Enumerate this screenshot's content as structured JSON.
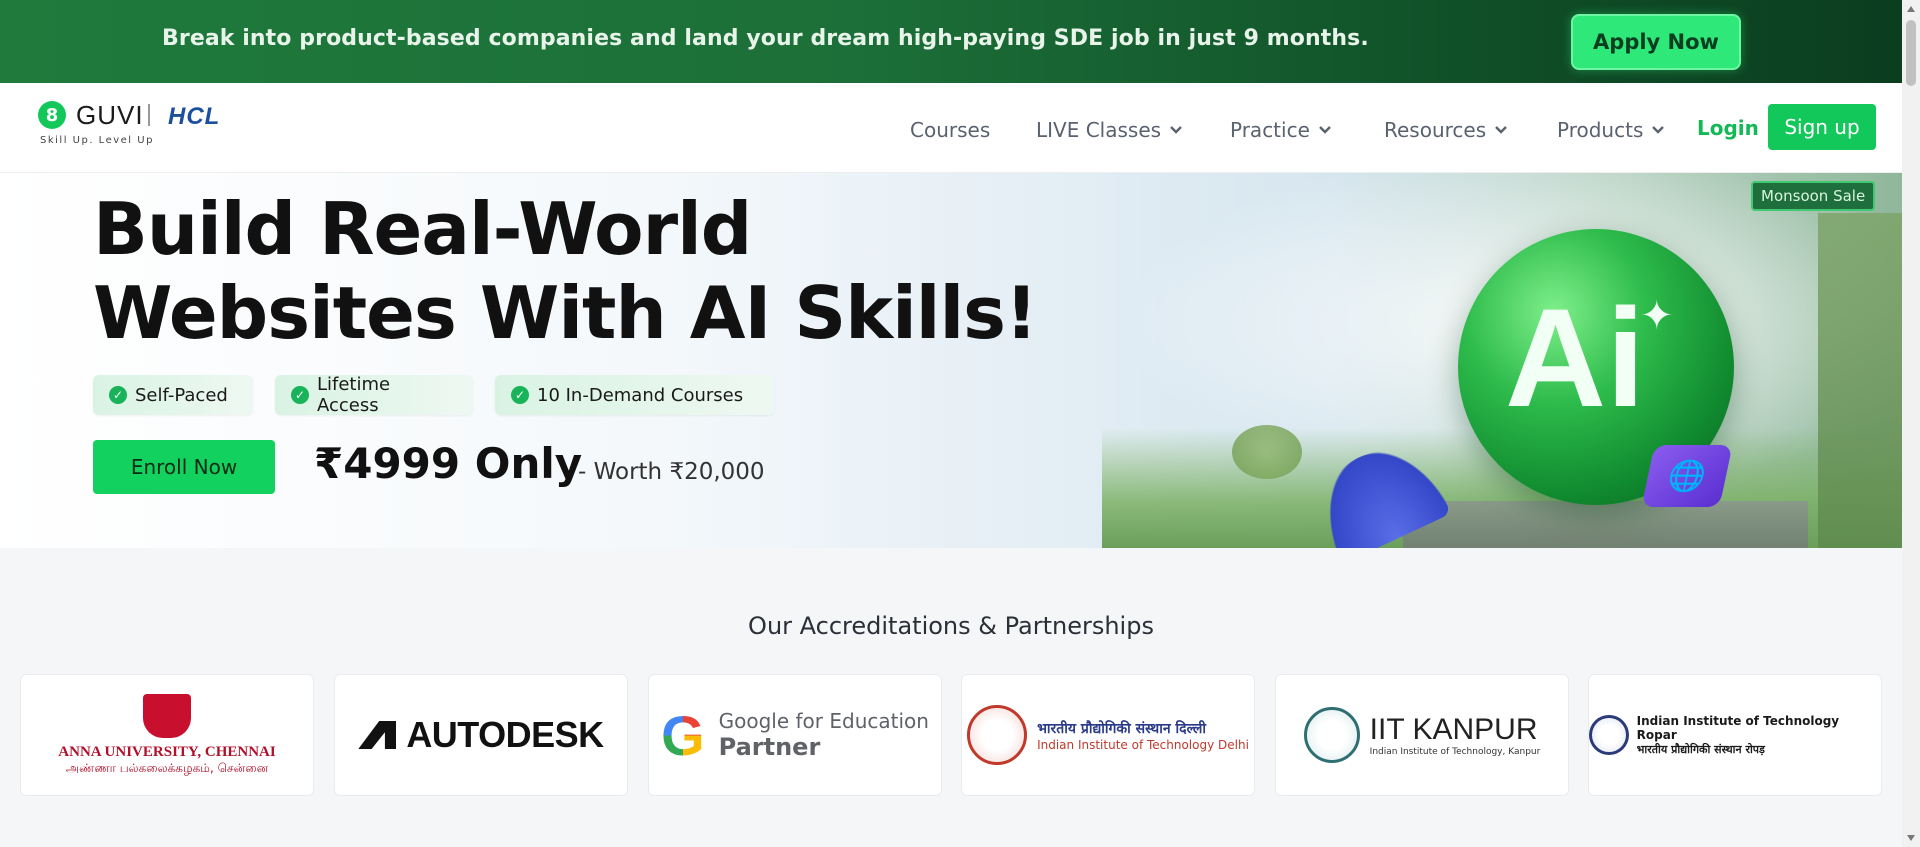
{
  "promo": {
    "text": "Break into product-based companies and land your dream high-paying SDE job in just 9 months.",
    "cta": "Apply Now"
  },
  "nav": {
    "logo": {
      "name": "GUVI",
      "partner": "HCL",
      "tagline": "Skill Up. Level Up"
    },
    "items": [
      {
        "label": "Courses",
        "dropdown": false
      },
      {
        "label": "LIVE Classes",
        "dropdown": true
      },
      {
        "label": "Practice",
        "dropdown": true
      },
      {
        "label": "Resources",
        "dropdown": true
      },
      {
        "label": "Products",
        "dropdown": true
      }
    ],
    "login": "Login",
    "signup": "Sign up"
  },
  "hero": {
    "title_line1": "Build Real-World",
    "title_line2": "Websites With AI Skills!",
    "chips": [
      "Self-Paced",
      "Lifetime Access",
      "10 In-Demand Courses"
    ],
    "enroll": "Enroll Now",
    "price": "₹4999 Only",
    "worth": "- Worth ₹20,000",
    "badge": "Monsoon Sale",
    "ai_text": "Ai"
  },
  "accreditations": {
    "title": "Our Accreditations & Partnerships",
    "anna": {
      "name": "ANNA UNIVERSITY, CHENNAI",
      "sub": "அண்ணா பல்கலைக்கழகம், சென்னை"
    },
    "autodesk": "AUTODESK",
    "google": {
      "letter": "G",
      "line1": "Google for Education",
      "line2": "Partner"
    },
    "iitd": {
      "hindi": "भारतीय प्रौद्योगिकी संस्थान दिल्ली",
      "english": "Indian Institute of Technology Delhi"
    },
    "iitk": {
      "name": "IIT KANPUR",
      "sub": "Indian Institute of Technology, Kanpur"
    },
    "iitr": {
      "english": "Indian Institute of Technology Ropar",
      "hindi": "भारतीय प्रौद्योगिकी संस्थान रोपड़"
    }
  },
  "colors": {
    "brand_green": "#13c85a",
    "promo_bg": "#1f7a3c",
    "hcl_blue": "#1c4fa0"
  }
}
